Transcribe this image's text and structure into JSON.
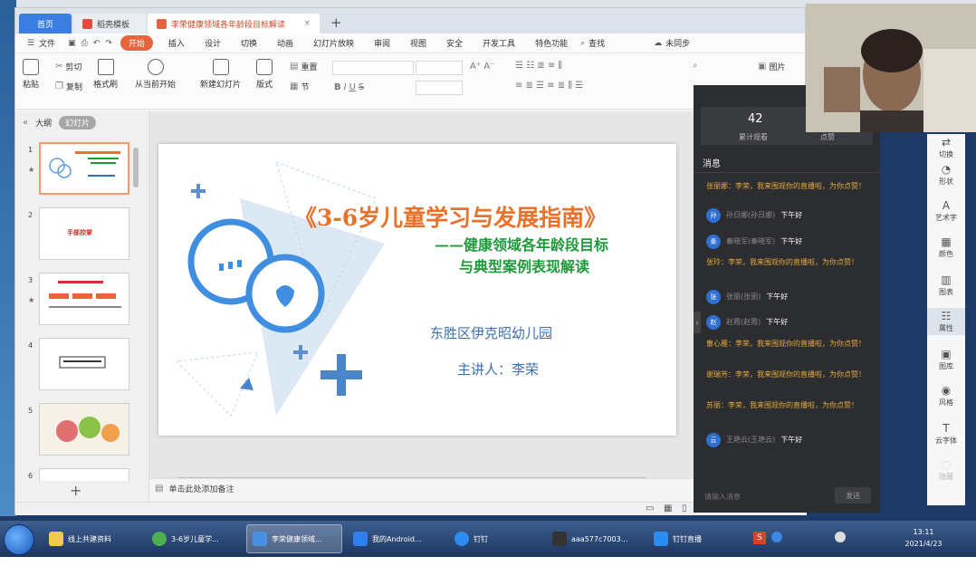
{
  "tabs": [
    {
      "label": "首页",
      "kind": "home"
    },
    {
      "label": "稻壳模板",
      "kind": "plain"
    },
    {
      "label": "李荣健康领域各年龄段目标解读",
      "kind": "active"
    }
  ],
  "menu": {
    "file": "文件",
    "start": "开始",
    "items": [
      "插入",
      "设计",
      "切换",
      "动画",
      "幻灯片放映",
      "审阅",
      "视图",
      "安全",
      "开发工具",
      "特色功能"
    ],
    "search": "查找",
    "sync": "未同步"
  },
  "ribbon": {
    "paste": "粘贴",
    "cut": "剪切",
    "copy": "复制",
    "format_painter": "格式刷",
    "play_from_current": "从当前开始",
    "new_slide": "新建幻灯片",
    "layout": "版式",
    "reset": "重置",
    "section": "节",
    "picture": "图片"
  },
  "left_panel": {
    "tabs": [
      "大纲",
      "幻灯片"
    ],
    "slide_numbers": [
      "1",
      "2",
      "3",
      "4",
      "5",
      "6"
    ],
    "thumb2_text": "手部控掌"
  },
  "slide": {
    "title": "《3-6岁儿童学习与发展指南》",
    "subtitle1": "——健康领域各年龄段目标",
    "subtitle2": "与典型案例表现解读",
    "organization": "东胜区伊克昭幼儿园",
    "speaker": "主讲人：李荣"
  },
  "notes_placeholder": "单击此处添加备注",
  "right_rail": [
    {
      "label": "切换",
      "icon": "transition-icon"
    },
    {
      "label": "形状",
      "icon": "shape-icon"
    },
    {
      "label": "艺术字",
      "icon": "art-text-icon"
    },
    {
      "label": "颜色",
      "icon": "color-icon"
    },
    {
      "label": "图表",
      "icon": "chart-icon"
    },
    {
      "label": "属性",
      "icon": "property-icon"
    },
    {
      "label": "图库",
      "icon": "gallery-icon"
    },
    {
      "label": "风格",
      "icon": "style-icon"
    },
    {
      "label": "云字体",
      "icon": "cloud-font-icon"
    },
    {
      "label": "隐藏",
      "icon": "hide-icon"
    }
  ],
  "live": {
    "viewer_count": "42",
    "viewer_caption": "累计观看",
    "like_caption": "点赞",
    "messages_title": "消息",
    "messages": [
      {
        "type": "sys",
        "text": "张丽娜：李荣，我来围观你的直播啦，为你点赞！"
      },
      {
        "type": "user",
        "avatar": "孙",
        "name": "孙日娜(孙日娜)",
        "text": "下午好"
      },
      {
        "type": "user",
        "avatar": "秦",
        "name": "秦晓军(秦晓军)",
        "text": "下午好"
      },
      {
        "type": "sys",
        "text": "张玲：李荣，我来围观你的直播啦，为你点赞！"
      },
      {
        "type": "user",
        "avatar": "张",
        "name": "张丽(张丽)",
        "text": "下午好"
      },
      {
        "type": "user",
        "avatar": "赵",
        "name": "赵霞(赵霞)",
        "text": "下午好"
      },
      {
        "type": "sys",
        "text": "曹心雁：李荣，我来围观你的直播啦，为你点赞！"
      },
      {
        "type": "sys",
        "text": "谢瑞芳：李荣，我来围观你的直播啦，为你点赞！"
      },
      {
        "type": "sys",
        "text": "苏丽：李荣，我来围观你的直播啦，为你点赞！"
      },
      {
        "type": "user",
        "avatar": "云",
        "name": "王艳云(王艳云)",
        "text": "下午好"
      }
    ],
    "input_placeholder": "请输入消息",
    "send": "发送"
  },
  "taskbar": {
    "items": [
      {
        "label": "线上共建资料",
        "color": "#f2c94c"
      },
      {
        "label": "3-6岁儿童学...",
        "color": "#4caf50"
      },
      {
        "label": "李荣健康领域...",
        "color": "#4a90e2"
      },
      {
        "label": "我的Android...",
        "color": "#2f80ed"
      },
      {
        "label": "钉钉",
        "color": "#2d8cf0"
      },
      {
        "label": "aaa577c7003...",
        "color": "#333333"
      },
      {
        "label": "钉钉直播",
        "color": "#2d8cf0"
      }
    ],
    "time": "13:11",
    "date": "2021/4/23"
  }
}
